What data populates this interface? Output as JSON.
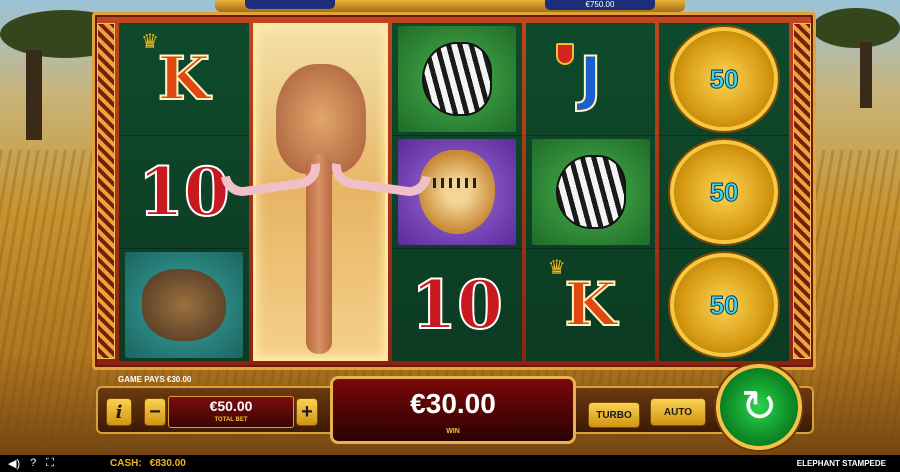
{
  "top_bar": {
    "balance_display": "€750.00"
  },
  "reels": {
    "reel1": [
      "K",
      "10",
      "wildebeest"
    ],
    "reel2": "elephant",
    "reel3": [
      "zebra",
      "cheetah",
      "10"
    ],
    "reel4": [
      "J",
      "zebra",
      "K"
    ],
    "reel5": [
      "50",
      "50",
      "50"
    ]
  },
  "controls": {
    "game_pays": "GAME PAYS €30.00",
    "info_label": "i",
    "minus_label": "−",
    "plus_label": "+",
    "total_bet_value": "€50.00",
    "total_bet_label": "TOTAL BET",
    "win_value": "€30.00",
    "win_label": "WIN",
    "turbo_label": "TURBO",
    "auto_label": "AUTO",
    "spin_icon": "↻"
  },
  "status_bar": {
    "icons": [
      "sound-icon",
      "help-icon",
      "fullscreen-icon"
    ],
    "icon_glyphs": [
      "◀)",
      "?",
      "⛶"
    ],
    "cash_label": "CASH:",
    "cash_value": "€830.00",
    "game_title": "ELEPHANT STAMPEDE"
  },
  "colors": {
    "accent_gold": "#f3c24a",
    "win_red": "#7a0808",
    "spin_green": "#0d8a26"
  }
}
